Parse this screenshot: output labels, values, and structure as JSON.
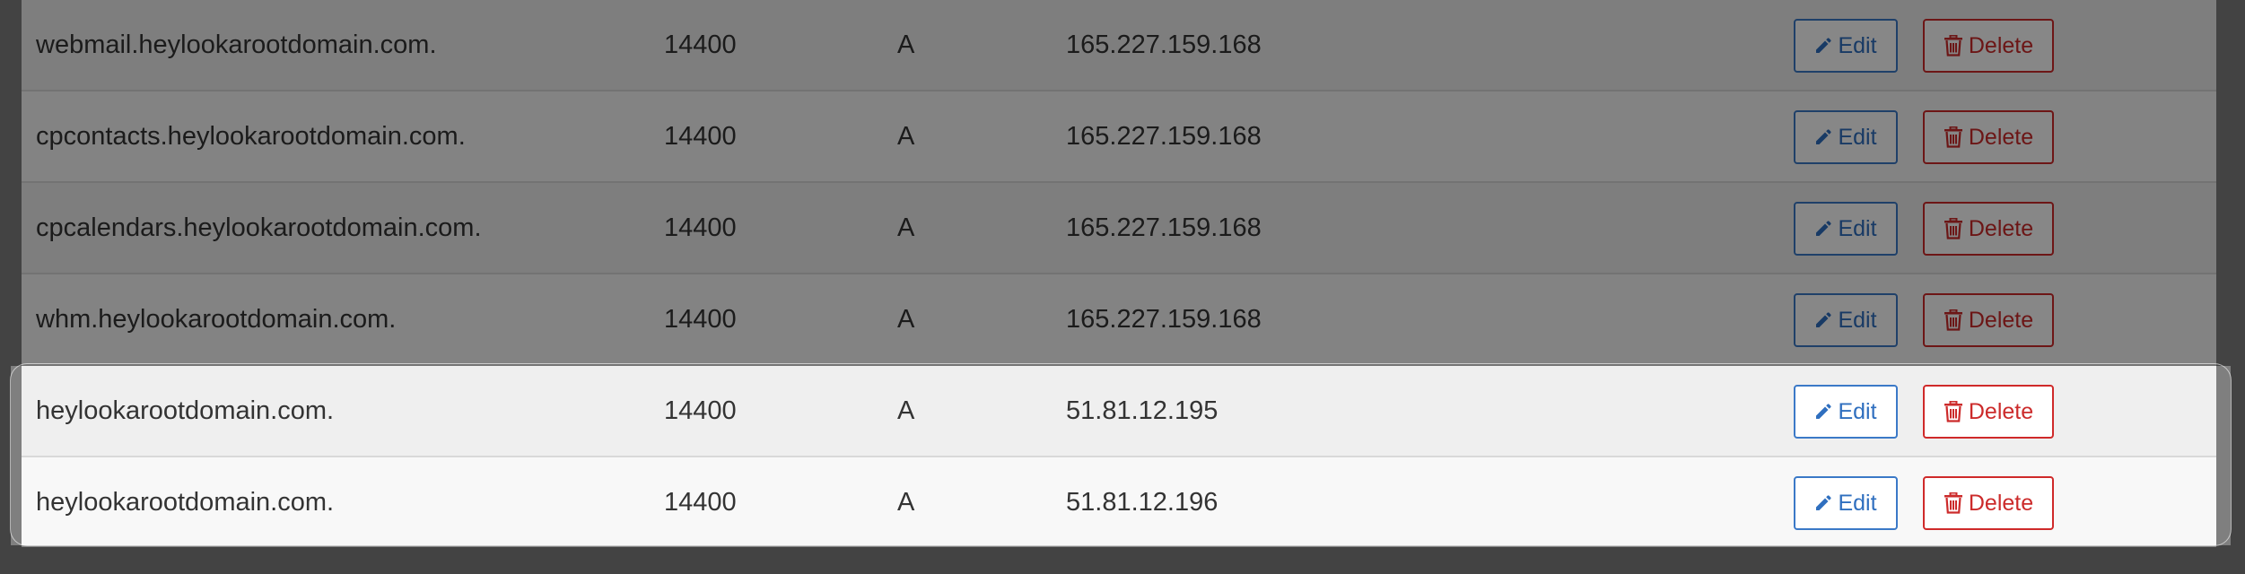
{
  "dns_records": [
    {
      "name": "webmail.heylookarootdomain.com.",
      "ttl": "14400",
      "type": "A",
      "record": "165.227.159.168",
      "highlighted": false
    },
    {
      "name": "cpcontacts.heylookarootdomain.com.",
      "ttl": "14400",
      "type": "A",
      "record": "165.227.159.168",
      "highlighted": false
    },
    {
      "name": "cpcalendars.heylookarootdomain.com.",
      "ttl": "14400",
      "type": "A",
      "record": "165.227.159.168",
      "highlighted": false
    },
    {
      "name": "whm.heylookarootdomain.com.",
      "ttl": "14400",
      "type": "A",
      "record": "165.227.159.168",
      "highlighted": false
    },
    {
      "name": "heylookarootdomain.com.",
      "ttl": "14400",
      "type": "A",
      "record": "51.81.12.195",
      "highlighted": true
    },
    {
      "name": "heylookarootdomain.com.",
      "ttl": "14400",
      "type": "A",
      "record": "51.81.12.196",
      "highlighted": true
    }
  ],
  "actions": {
    "edit_label": "Edit",
    "delete_label": "Delete",
    "edit_icon": "pencil-icon",
    "delete_icon": "trash-icon"
  },
  "colors": {
    "edit": "#2f6fbf",
    "delete": "#cc2b2b",
    "overlay": "rgba(0,0,0,0.47)"
  }
}
